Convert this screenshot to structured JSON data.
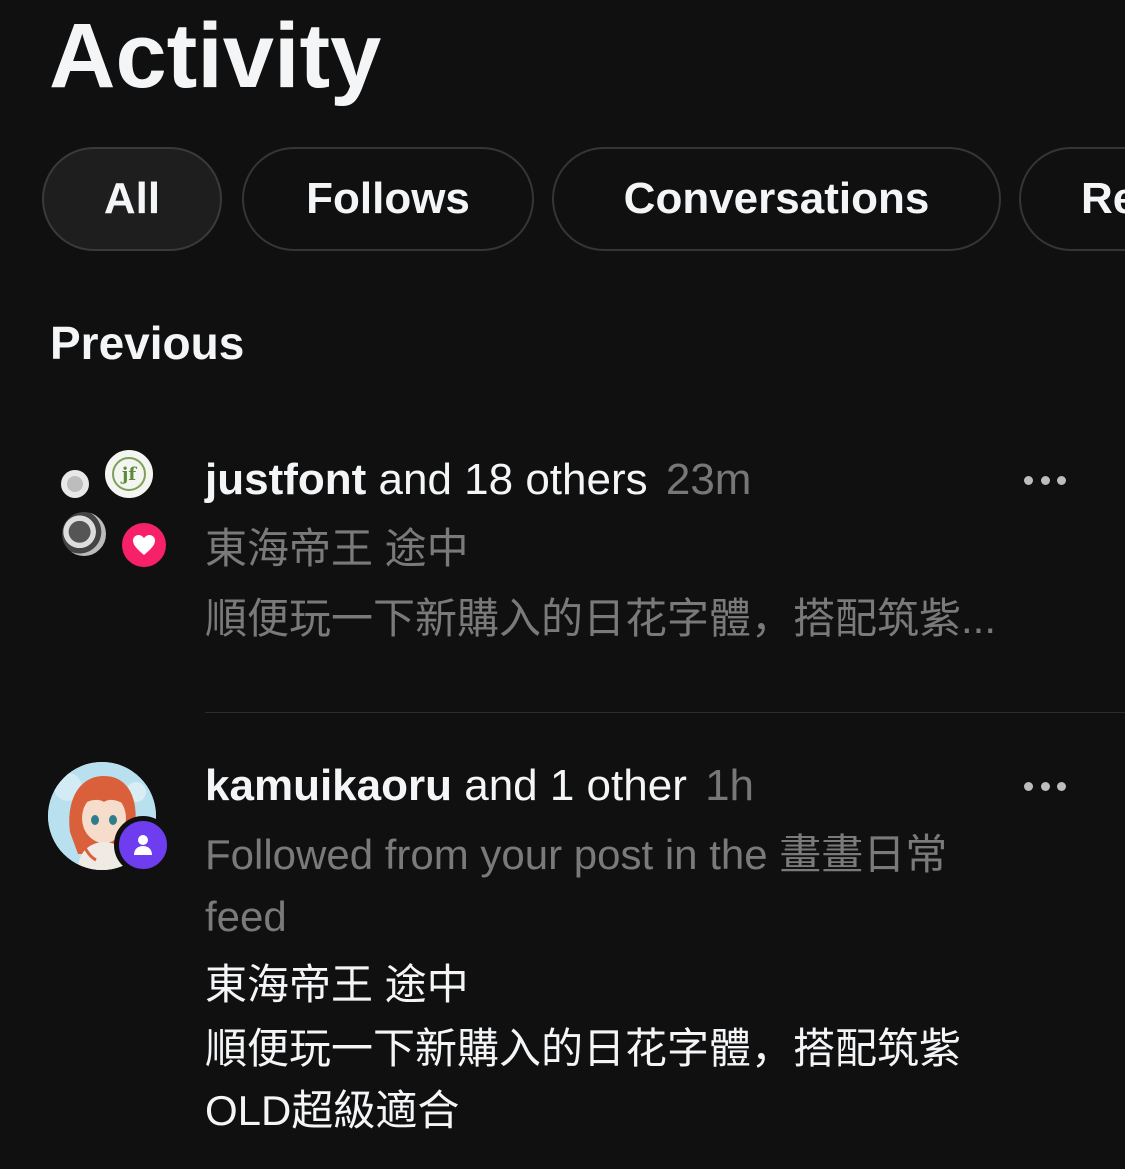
{
  "header": {
    "title": "Activity"
  },
  "tabs": [
    {
      "label": "All",
      "active": true
    },
    {
      "label": "Follows",
      "active": false
    },
    {
      "label": "Conversations",
      "active": false
    },
    {
      "label": "Re",
      "active": false
    }
  ],
  "section": {
    "heading": "Previous"
  },
  "activities": [
    {
      "actor": "justfont",
      "others": "and 18 others",
      "time": "23m",
      "line1": "東海帝王 途中",
      "line2": "順便玩一下新購入的日花字體，搭配筑紫...",
      "avatar_initials": "jf",
      "badge_icon": "heart-icon",
      "badge_color": "#f7216a",
      "more_icon": "more-horizontal-icon"
    },
    {
      "actor": "kamuikaoru",
      "others": "and 1 other",
      "time": "1h",
      "context_line1": "Followed from your post in the 畫畫日常",
      "context_line2": "feed",
      "post_line1": "東海帝王 途中",
      "post_line2": "順便玩一下新購入的日花字體，搭配筑紫",
      "post_line3": "OLD超級適合",
      "badge_icon": "person-icon",
      "badge_color": "#6e3def",
      "more_icon": "more-horizontal-icon"
    }
  ]
}
